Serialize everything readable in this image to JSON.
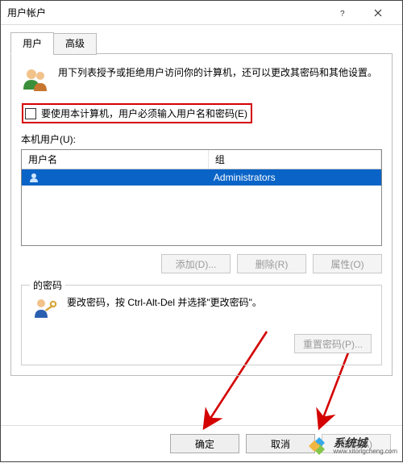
{
  "window": {
    "title": "用户帐户",
    "help_icon": "help-icon",
    "close_icon": "close-icon"
  },
  "tabs": {
    "user": "用户",
    "advanced": "高级"
  },
  "intro": "用下列表授予或拒绝用户访问你的计算机，还可以更改其密码和其他设置。",
  "checkbox": {
    "label": "要使用本计算机，用户必须输入用户名和密码(E)"
  },
  "userlist": {
    "label": "本机用户(U):",
    "cols": {
      "name": "用户名",
      "group": "组"
    },
    "rows": [
      {
        "name": "",
        "group": "Administrators"
      }
    ]
  },
  "buttons": {
    "add": "添加(D)...",
    "remove": "删除(R)",
    "props": "属性(O)"
  },
  "password_group": {
    "legend": "的密码",
    "text": "要改密码，按 Ctrl-Alt-Del 并选择\"更改密码\"。",
    "reset": "重置密码(P)..."
  },
  "footer": {
    "ok": "确定",
    "cancel": "取消",
    "apply": "应用(A)"
  },
  "watermark": {
    "name": "系统城",
    "url": "www.xitongcheng.com"
  }
}
